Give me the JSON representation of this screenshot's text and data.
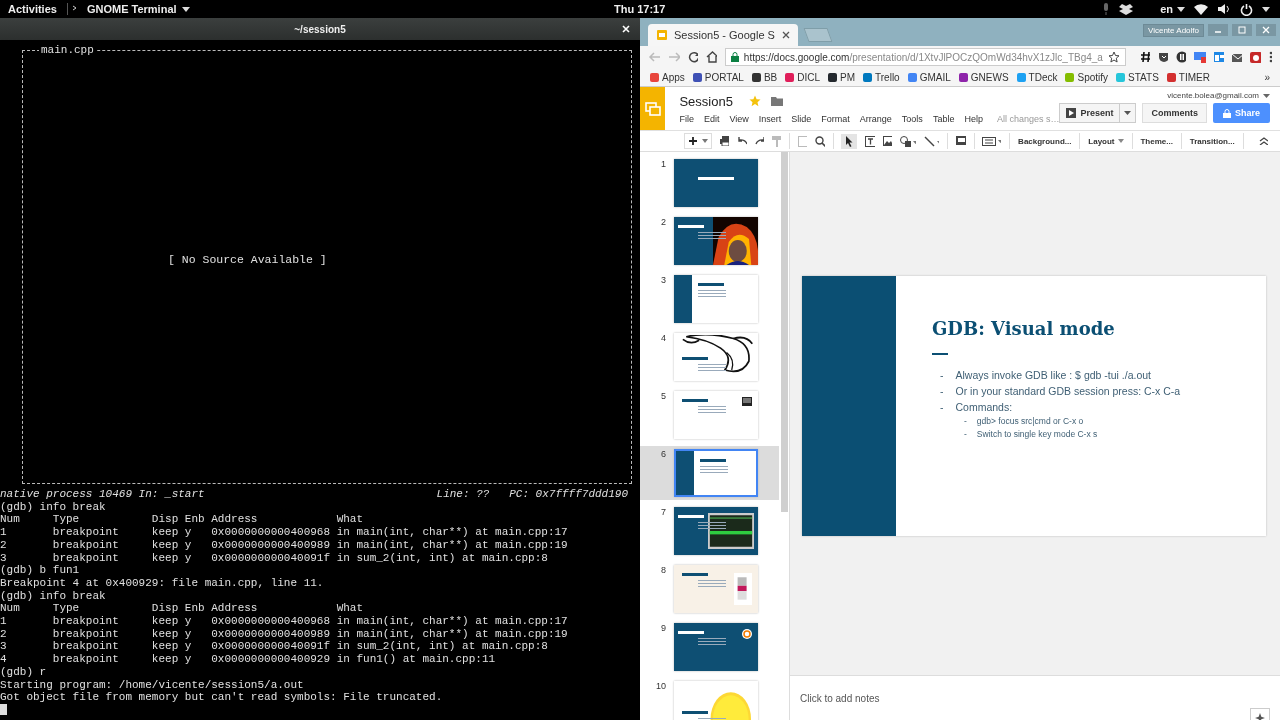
{
  "top_bar": {
    "activities": "Activities",
    "app_menu": "GNOME Terminal",
    "clock": "Thu 17:17",
    "language": "en"
  },
  "terminal": {
    "title": "~/session5",
    "source_file": "main.cpp",
    "source_message": "[ No Source Available ]",
    "status_left": "native process 10469 In: _start",
    "status_right": "Line: ??   PC: 0x7ffff7ddd190",
    "lines": [
      "(gdb) info break",
      "Num     Type           Disp Enb Address            What",
      "1       breakpoint     keep y   0x0000000000400968 in main(int, char**) at main.cpp:17",
      "2       breakpoint     keep y   0x0000000000400989 in main(int, char**) at main.cpp:19",
      "3       breakpoint     keep y   0x000000000040091f in sum_2(int, int) at main.cpp:8",
      "(gdb) b fun1",
      "Breakpoint 4 at 0x400929: file main.cpp, line 11.",
      "(gdb) info break",
      "Num     Type           Disp Enb Address            What",
      "1       breakpoint     keep y   0x0000000000400968 in main(int, char**) at main.cpp:17",
      "2       breakpoint     keep y   0x0000000000400989 in main(int, char**) at main.cpp:19",
      "3       breakpoint     keep y   0x000000000040091f in sum_2(int, int) at main.cpp:8",
      "4       breakpoint     keep y   0x0000000000400929 in fun1() at main.cpp:11",
      "(gdb) r",
      "Starting program: /home/vicente/session5/a.out",
      "Got object file from memory but can't read symbols: File truncated."
    ]
  },
  "browser": {
    "profile": "Vicente Adolfo",
    "tabs": [
      {
        "label": "Session5 - Google S",
        "selected": true
      }
    ],
    "url_host": "https://docs.google.com",
    "url_path": "/presentation/d/1XtvJlPOCzQOmWd34hvX1zJlc_TBg4_a",
    "bookmarks": [
      {
        "label": "Apps",
        "color": "#e8453c"
      },
      {
        "label": "PORTAL",
        "color": "#3f51b5"
      },
      {
        "label": "BB",
        "color": "#333333"
      },
      {
        "label": "DICL",
        "color": "#e01e5a"
      },
      {
        "label": "PM",
        "color": "#24292e"
      },
      {
        "label": "Trello",
        "color": "#0079bf"
      },
      {
        "label": "GMAIL",
        "color": "#4285f4"
      },
      {
        "label": "GNEWS",
        "color": "#8e24aa"
      },
      {
        "label": "TDeck",
        "color": "#1da1f2"
      },
      {
        "label": "Spotify",
        "color": "#84bd00"
      },
      {
        "label": "STATS",
        "color": "#26c6da"
      },
      {
        "label": "TIMER",
        "color": "#d32f2f"
      }
    ],
    "more": "»"
  },
  "slides_app": {
    "doc_title": "Session5",
    "menu": [
      "File",
      "Edit",
      "View",
      "Insert",
      "Slide",
      "Format",
      "Arrange",
      "Tools",
      "Table",
      "Help"
    ],
    "save_status": "All changes s…",
    "account": "vicente.bolea@gmail.com",
    "present": "Present",
    "comments": "Comments",
    "share": "Share",
    "toolbar_buttons": [
      "Background...",
      "Layout",
      "Theme...",
      "Transition..."
    ],
    "thumbnails": [
      {
        "number": "1",
        "kind": "title",
        "selected": false
      },
      {
        "number": "2",
        "selected": false
      },
      {
        "number": "3",
        "kind": "sidebar",
        "selected": false
      },
      {
        "number": "4",
        "kind": "drawing",
        "selected": false
      },
      {
        "number": "5",
        "kind": "plain",
        "selected": false
      },
      {
        "number": "6",
        "kind": "sidebar",
        "selected": true
      },
      {
        "number": "7",
        "kind": "screen",
        "selected": false
      },
      {
        "number": "8",
        "kind": "cream",
        "selected": false
      },
      {
        "number": "9",
        "kind": "badge",
        "selected": false
      },
      {
        "number": "10",
        "kind": "emoji",
        "selected": false
      }
    ],
    "slide": {
      "title": "GDB: Visual mode",
      "bullets": [
        {
          "text": "Always invoke GDB like : $ gdb -tui ./a.out"
        },
        {
          "text": "Or in your standard GDB session press: C-x C-a"
        },
        {
          "text": "Commands:",
          "children": [
            {
              "text": "gdb> focus src|cmd or C-x o"
            },
            {
              "text": "Switch to single key mode C-x s"
            }
          ]
        }
      ],
      "bullet_mark": "-"
    },
    "notes_placeholder": "Click to add notes"
  }
}
